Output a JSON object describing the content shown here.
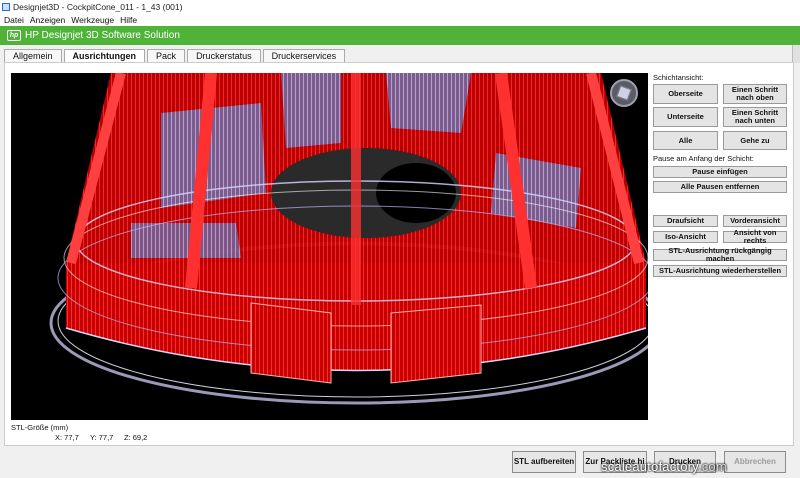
{
  "window": {
    "title": "Designjet3D - CockpitCone_011 - 1_43 (001)"
  },
  "menu": [
    "Datei",
    "Anzeigen",
    "Werkzeuge",
    "Hilfe"
  ],
  "brand": {
    "logo_text": "hp",
    "title": "HP Designjet 3D Software Solution",
    "color": "#4fb33a"
  },
  "tabs": [
    "Allgemein",
    "Ausrichtungen",
    "Pack",
    "Druckerstatus",
    "Druckerservices"
  ],
  "active_tab": "Ausrichtungen",
  "layer_view": {
    "label": "Schichtansicht:",
    "top": "Oberseite",
    "step_up": "Einen Schritt nach oben",
    "bottom": "Unterseite",
    "step_down": "Einen Schritt nach unten",
    "all": "Alle",
    "goto": "Gehe zu"
  },
  "pause": {
    "label": "Pause am Anfang der Schicht:",
    "insert": "Pause einfügen",
    "remove_all": "Alle Pausen entfernen"
  },
  "views": {
    "top": "Draufsicht",
    "front": "Vorderansicht",
    "iso": "Iso-Ansicht",
    "right": "Ansicht von rechts",
    "undo_stl": "STL-Ausrichtung rückgängig machen",
    "restore_stl": "STL-Ausrichtung wiederherstellen"
  },
  "stl_size": {
    "label": "STL-Größe (mm)",
    "x": "X: 77,7",
    "y": "Y: 77,7",
    "z": "Z: 69,2"
  },
  "actions": {
    "prepare": "STL aufbereiten",
    "packlist": "Zur Packliste hi",
    "print": "Drucken",
    "cancel": "Abbrechen"
  },
  "watermark": {
    "name": "scaleautofactory",
    "suffix": ".com"
  },
  "colors": {
    "model_red": "#ff1a1a",
    "model_lilac": "#b8b8ff",
    "viewport_bg": "#000000"
  }
}
